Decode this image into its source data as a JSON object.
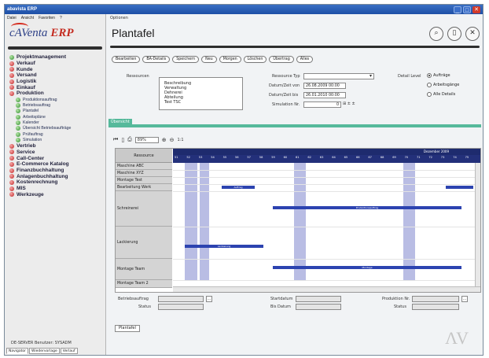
{
  "window": {
    "title": "abavista ERP"
  },
  "menubar": [
    "Datei",
    "Ansicht",
    "Favoriten",
    "?"
  ],
  "logo": {
    "brand": "cAVenta",
    "suffix": "ERP"
  },
  "sidebar": {
    "items": [
      {
        "label": "Projektmanagement",
        "color": "green"
      },
      {
        "label": "Verkauf",
        "color": "red"
      },
      {
        "label": "Kunde",
        "color": "red"
      },
      {
        "label": "Versand",
        "color": "red"
      },
      {
        "label": "Logistik",
        "color": "red"
      },
      {
        "label": "Einkauf",
        "color": "red"
      },
      {
        "label": "Produktion",
        "color": "red"
      }
    ],
    "sub_items": [
      "Produktionsauftrag",
      "Betriebsauftrag",
      "Plantafel",
      "Arbeitspläne",
      "Kalender",
      "Übersicht Betriebsaufträge",
      "Prüfauftrag",
      "Simulation"
    ],
    "items_after": [
      {
        "label": "Vertrieb",
        "color": "red"
      },
      {
        "label": "Service",
        "color": "red"
      },
      {
        "label": "Call-Center",
        "color": "red"
      },
      {
        "label": "E-Commerce Katalog",
        "color": "red"
      },
      {
        "label": "Finanzbuchhaltung",
        "color": "red"
      },
      {
        "label": "Anlagenbuchhaltung",
        "color": "red"
      },
      {
        "label": "Kostenrechnung",
        "color": "red"
      },
      {
        "label": "MIS",
        "color": "red"
      },
      {
        "label": "Werkzeuge",
        "color": "red"
      }
    ],
    "status": "DE-SERVER  Benutzer: SYSADM",
    "tabs": [
      "Navigator",
      "Wiedervorlage",
      "Verlauf"
    ]
  },
  "main": {
    "options_label": "Optionen",
    "page_title": "Plantafel",
    "header_icons": [
      "search-icon",
      "document-icon",
      "close-icon"
    ],
    "toolbar_buttons": [
      "Bearbeiten",
      "BA-Details",
      "Speichern",
      "Neu",
      "Morgen",
      "Löschen",
      "Übertrag",
      "Alles"
    ],
    "ressourcen_label": "Ressourcen",
    "ressourcen_list": [
      "Beschreibung",
      "Verwaltung",
      "Dehnerei",
      "Abteilung",
      "Test TSC"
    ],
    "ressource_typ_label": "Ressource Typ",
    "start_label": "Datum/Zeit von",
    "start_value": "26.08.2009 00:00",
    "end_label": "Datum/Zeit bis",
    "end_value": "26.01.2010 00:00",
    "simulation_label": "Simulation Nr.",
    "simulation_value": "0",
    "detail_label": "Detail Level",
    "detail_options": [
      "Aufträge",
      "Arbeitsgänge",
      "Alle Details"
    ],
    "detail_selected": 0,
    "tab_label": "Übersicht",
    "zoom_value": "89%",
    "ratio_label": "1:1",
    "gantt": {
      "resource_header": "Ressource",
      "month_label": "Dezember 2009",
      "day_labels": [
        "51",
        "52",
        "53",
        "54",
        "55",
        "56",
        "57",
        "58",
        "59",
        "60",
        "61",
        "62",
        "63",
        "64",
        "65",
        "66",
        "67",
        "68",
        "69",
        "70",
        "71",
        "72",
        "73",
        "74",
        "75"
      ],
      "resources": [
        "Maschine ABC",
        "Maschine XYZ",
        "Montage Test",
        "Bearbeitung Werk",
        "Schreinerei",
        "Lackierung",
        "Montage Team",
        "Montage Team 2"
      ],
      "bars": [
        {
          "row": 2,
          "label": "Auftrag"
        },
        {
          "row": 2,
          "label": ""
        },
        {
          "row": 4,
          "label": "Produktionsauftrag"
        },
        {
          "row": 5,
          "label": "Lackierung"
        },
        {
          "row": 6,
          "label": "Montage"
        }
      ]
    },
    "form": {
      "betriebsauftrag_label": "Betriebsauftrag",
      "status_label": "Status",
      "start_datum_label": "Startdatum",
      "bis_datum_label": "Bis Datum",
      "produktion_nr_label": "Produktion Nr.",
      "status2_label": "Status"
    },
    "bottom_tab": "Plantafel"
  }
}
